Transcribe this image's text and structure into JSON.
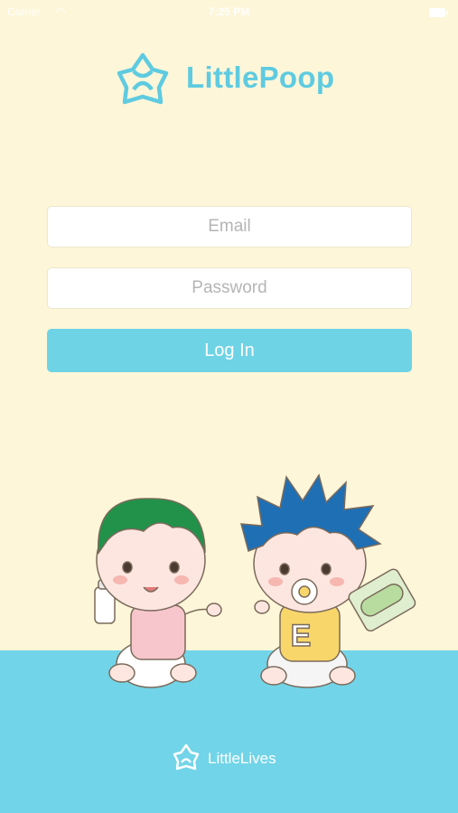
{
  "status_bar": {
    "carrier": "Carrier",
    "time": "7:25 PM"
  },
  "app": {
    "name": "LittlePoop"
  },
  "form": {
    "email_placeholder": "Email",
    "password_placeholder": "Password",
    "login_label": "Log In"
  },
  "illustration": {
    "shirt_letter": "E"
  },
  "footer": {
    "brand": "LittleLives"
  },
  "colors": {
    "background": "#fef6d9",
    "accent": "#6fd3e6",
    "logo": "#5ecbe0",
    "floor": "#72d4e8"
  },
  "icons": [
    "wifi-icon",
    "battery-icon",
    "littlepoop-logo-icon",
    "littlelives-logo-icon"
  ]
}
